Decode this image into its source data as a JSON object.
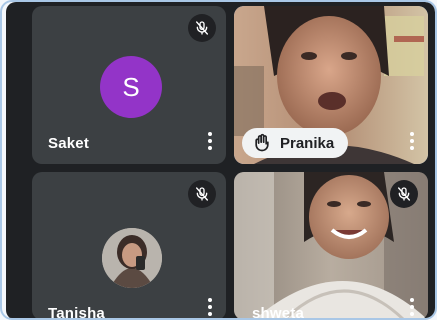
{
  "participants": [
    {
      "name": "Saket",
      "initial": "S",
      "avatar_color": "#9334c8",
      "muted": true,
      "icon": "mic-off-icon"
    },
    {
      "name": "Pranika",
      "hand_raised": true,
      "icon": "raised-hand-icon"
    },
    {
      "name": "Tanisha",
      "muted": true,
      "icon": "mic-off-icon"
    },
    {
      "name": "shweta",
      "muted": true,
      "icon": "mic-off-icon"
    }
  ],
  "colors": {
    "tile_bg": "#3c4043",
    "stage_bg": "#1f2124",
    "active_border": "#8ab4f8",
    "frame_border": "#a9c7e6"
  }
}
